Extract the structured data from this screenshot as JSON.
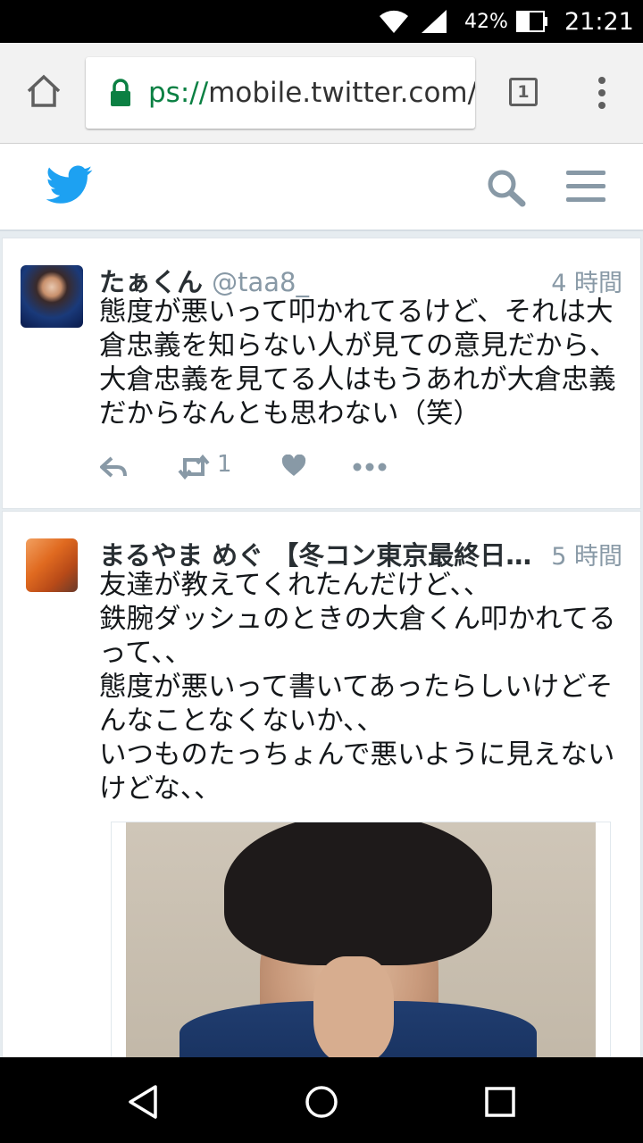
{
  "status_bar": {
    "battery": "42%",
    "time": "21:21"
  },
  "browser": {
    "url_scheme": "ps://",
    "url_rest": "mobile.twitter.com/s",
    "tab_count": "1"
  },
  "tweets": [
    {
      "name": "たぁくん",
      "handle": "@taa8_",
      "time": "4 時間",
      "text": "態度が悪いって叩かれてるけど、それは大\n倉忠義を知らない人が見ての意見だから、\n大倉忠義を見てる人はもうあれが大倉忠義\nだからなんとも思わない（笑）",
      "retweet_count": "1"
    },
    {
      "name": "まるやま めぐ 【冬コン東京最終日…",
      "handle": "",
      "time": "5 時間",
      "text": "友達が教えてくれたんだけど、、\n鉄腕ダッシュのときの大倉くん叩かれてる\nって、、\n態度が悪いって書いてあったらしいけどそ\nんなことなくないか、、\nいつものたっちょんで悪いように見えない\nけどな、、"
    }
  ],
  "colors": {
    "twitter_blue": "#1da1f2",
    "icon_gray": "#8899a6",
    "secure_green": "#0b8043"
  }
}
